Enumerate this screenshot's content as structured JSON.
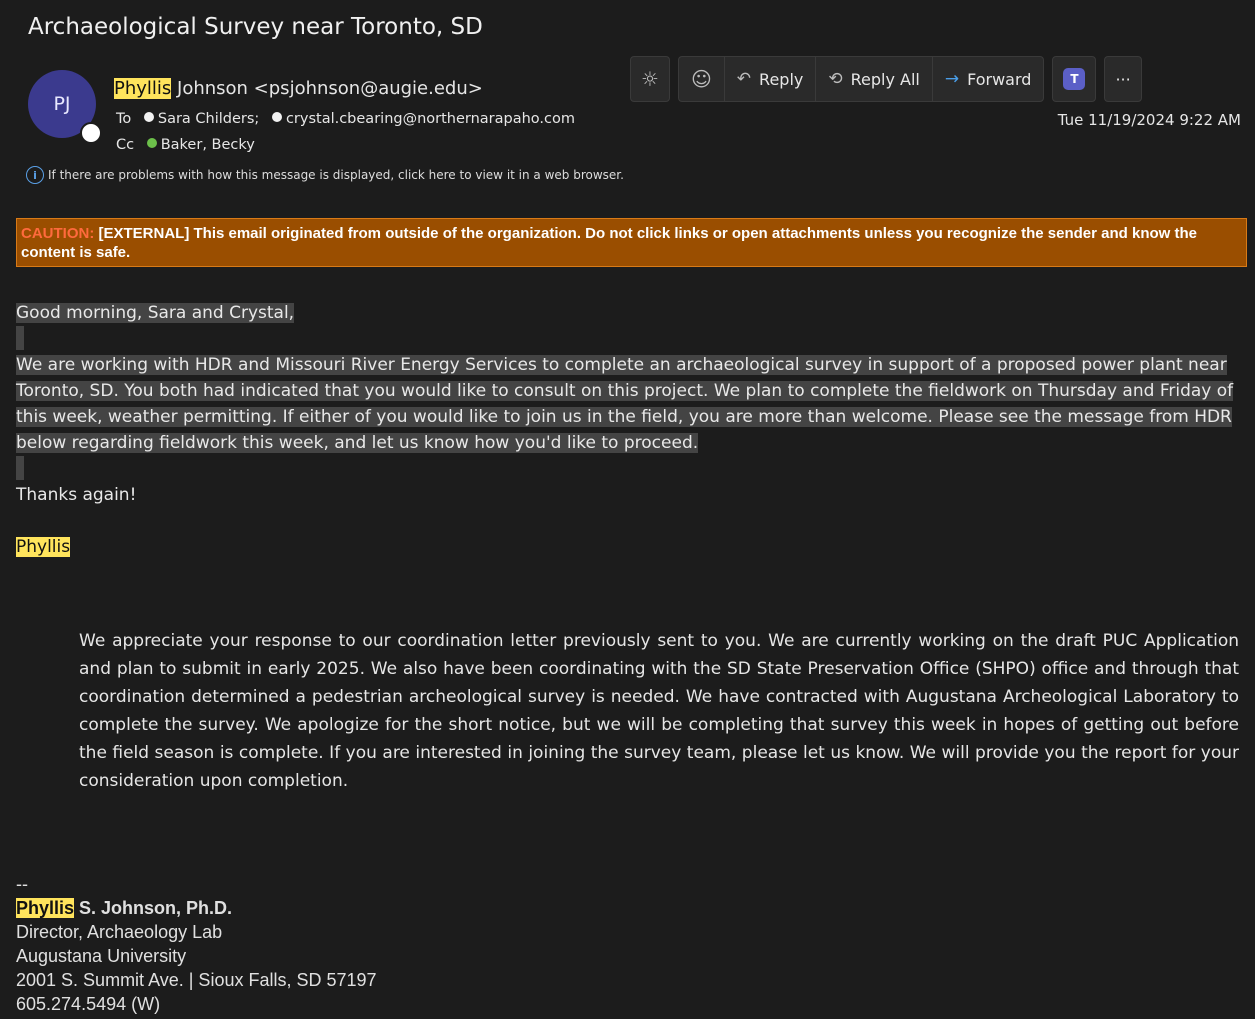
{
  "subject": "Archaeological Survey near Toronto, SD",
  "sender": {
    "initials": "PJ",
    "first_name": "Phyllis",
    "rest": " Johnson <psjohnson@augie.edu>"
  },
  "to": {
    "label": "To",
    "recipients": [
      "Sara Childers;",
      "crystal.cbearing@northernarapaho.com"
    ]
  },
  "cc": {
    "label": "Cc",
    "recipients": [
      "Baker, Becky"
    ]
  },
  "info_bar": "If there are problems with how this message is displayed, click here to view it in a web browser.",
  "toolbar": {
    "reply": "Reply",
    "reply_all": "Reply All",
    "forward": "Forward",
    "more": "···",
    "teams": "T"
  },
  "date": "Tue 11/19/2024 9:22 AM",
  "caution": {
    "label": "CAUTION:",
    "text": " [EXTERNAL] This email originated from outside of the organization. Do not click links or open attachments unless you recognize the sender and know the content is safe."
  },
  "body": {
    "greeting": "Good morning, Sara and Crystal,",
    "paragraph": "We are working with HDR and Missouri River Energy Services to complete an archaeological survey in support of a proposed power plant near Toronto, SD. You both had indicated that you would like to consult on this project. We plan to complete the fieldwork on Thursday and Friday of this week, weather permitting. If either of you would like to join us in the field, you are more than welcome. Please see the message from HDR below regarding fieldwork this week, and let us know how you'd like to proceed.",
    "thanks": "Thanks again!",
    "signoff": "Phyllis"
  },
  "quote": "We appreciate your response to our coordination letter previously sent to you. We are currently working on the draft PUC Application and plan to submit in early 2025. We also have been coordinating with the SD State Preservation Office (SHPO) office and through that coordination determined a pedestrian archeological survey is needed. We have contracted with Augustana Archeological Laboratory to complete the survey. We apologize for the short notice, but we will be completing that survey this week in hopes of getting out before the field season is complete. If you are interested in joining the survey team, please let us know. We will provide you the report for your consideration upon completion.",
  "signature": {
    "dashes": "--",
    "first": "Phyllis",
    "name_rest": " S. Johnson, Ph.D.",
    "title": "Director, Archaeology Lab",
    "org": "Augustana University",
    "address": "2001 S. Summit Ave. | Sioux Falls, SD 57197",
    "phone": "605.274.5494 (W)"
  }
}
